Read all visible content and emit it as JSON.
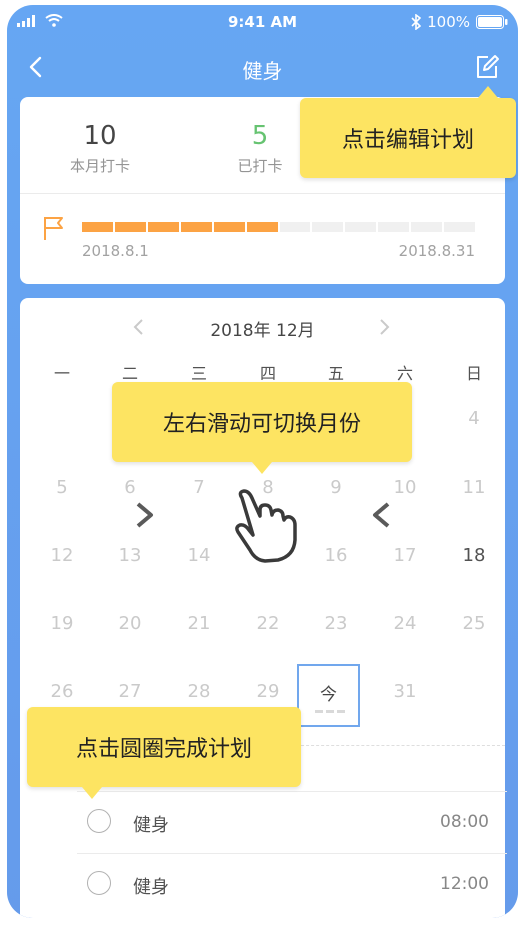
{
  "status_bar": {
    "time": "9:41 AM",
    "battery": "100%"
  },
  "nav": {
    "title": "健身"
  },
  "summary": {
    "month_count": "10",
    "month_label": "本月打卡",
    "done_count": "5",
    "done_label": "已打卡",
    "start_date": "2018.8.1",
    "end_date": "2018.8.31",
    "progress_fraction": 0.5,
    "colors": {
      "progress": "#fb8a10",
      "done_count": "#3cb34a",
      "accent": "#3b8ef0"
    }
  },
  "calendar": {
    "month_title": "2018年  12月",
    "weekdays": [
      "一",
      "二",
      "三",
      "四",
      "五",
      "六",
      "日"
    ],
    "rows": [
      [
        "",
        "",
        "",
        "",
        "",
        "",
        "4"
      ],
      [
        "5",
        "6",
        "7",
        "8",
        "9",
        "10",
        "11"
      ],
      [
        "12",
        "13",
        "14",
        "15",
        "16",
        "17",
        "18"
      ],
      [
        "19",
        "20",
        "21",
        "22",
        "23",
        "24",
        "25"
      ],
      [
        "26",
        "27",
        "28",
        "29",
        "今",
        "31",
        ""
      ]
    ],
    "highlight_day": "18",
    "today_label": "今"
  },
  "tasks": [
    {
      "name": "健身",
      "time": "08:00"
    },
    {
      "name": "健身",
      "time": "12:00"
    }
  ],
  "tooltips": {
    "edit": "点击编辑计划",
    "swipe": "左右滑动可切换月份",
    "check": "点击圆圈完成计划"
  },
  "icons": [
    "back-chevron-icon",
    "edit-icon",
    "flag-icon",
    "prev-month-icon",
    "next-month-icon",
    "swipe-left-arrow-icon",
    "swipe-right-arrow-icon",
    "hand-pointer-icon"
  ]
}
